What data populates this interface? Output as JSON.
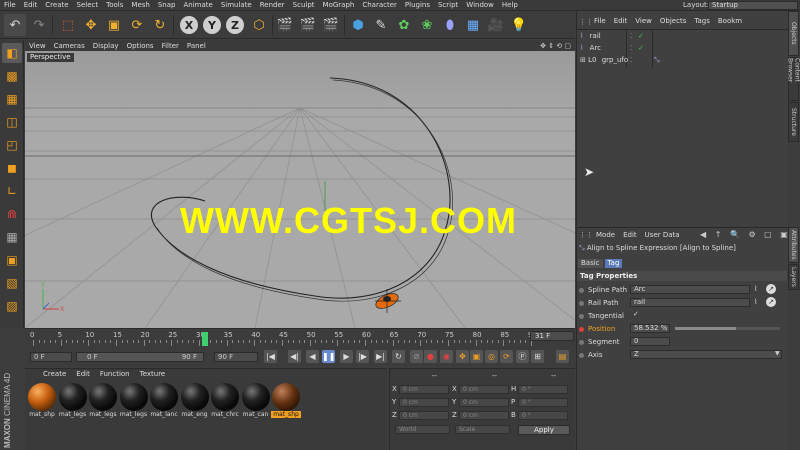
{
  "menu": [
    "File",
    "Edit",
    "Create",
    "Select",
    "Tools",
    "Mesh",
    "Snap",
    "Animate",
    "Simulate",
    "Render",
    "Sculpt",
    "MoGraph",
    "Character",
    "Plugins",
    "Script",
    "Window",
    "Help"
  ],
  "layout": {
    "label": "Layout:",
    "value": "Startup"
  },
  "axis_buttons": [
    "X",
    "Y",
    "Z"
  ],
  "viewport": {
    "menu": [
      "View",
      "Cameras",
      "Display",
      "Options",
      "Filter",
      "Panel"
    ],
    "name": "Perspective"
  },
  "watermark": "WWW.CGTSJ.COM",
  "timeline": {
    "ticks": [
      "0",
      "5",
      "10",
      "15",
      "20",
      "25",
      "30",
      "35",
      "40",
      "45",
      "50",
      "55",
      "60",
      "65",
      "70",
      "75",
      "80",
      "85",
      "90"
    ],
    "current": "31 F",
    "playhead": 31,
    "max": 90
  },
  "transport": {
    "start": "0 F",
    "range_start": "0 F",
    "range_end": "90 F",
    "end": "90 F"
  },
  "materials": {
    "menu": [
      "Create",
      "Edit",
      "Function",
      "Texture"
    ],
    "items": [
      "mat_shp",
      "mat_legs",
      "mat_legs",
      "mat_legs",
      "mat_lanc",
      "mat_eng",
      "mat_chrc",
      "mat_can",
      "mat_shp"
    ],
    "selected": 8
  },
  "coords": {
    "headers": [
      "--",
      "--",
      "--"
    ],
    "rows": [
      {
        "a": "X",
        "av": "0 cm",
        "b": "X",
        "bv": "0 cm",
        "c": "H",
        "cv": "0 °"
      },
      {
        "a": "Y",
        "av": "0 cm",
        "b": "Y",
        "bv": "0 cm",
        "c": "P",
        "cv": "0 °"
      },
      {
        "a": "Z",
        "av": "0 cm",
        "b": "Z",
        "bv": "0 cm",
        "c": "B",
        "cv": "0 °"
      }
    ],
    "space": "World",
    "mode": "Scale",
    "apply": "Apply"
  },
  "objects": {
    "menu": [
      "File",
      "Edit",
      "View",
      "Objects",
      "Tags",
      "Bookm"
    ],
    "rows": [
      "rail",
      "Arc",
      "grp_ufo"
    ]
  },
  "side_tabs": {
    "top": [
      "Objects",
      "Content Browser",
      "Structure"
    ],
    "bottom": [
      "Attributes",
      "Layers"
    ]
  },
  "attributes": {
    "menu": [
      "Mode",
      "Edit",
      "User Data"
    ],
    "title": "Align to Spline Expression [Align to Spline]",
    "tabs": [
      "Basic",
      "Tag"
    ],
    "section": "Tag Properties",
    "rows": [
      {
        "label": "Spline Path",
        "value": "Arc"
      },
      {
        "label": "Rail Path",
        "value": "rail"
      },
      {
        "label": "Tangential",
        "value": "✓"
      },
      {
        "label": "Position",
        "value": "58.532 %"
      },
      {
        "label": "Segment",
        "value": "0"
      },
      {
        "label": "Axis",
        "value": "Z"
      }
    ]
  },
  "brand": {
    "line1": "MAXON",
    "line2": "CINEMA 4D"
  },
  "colors": {
    "accent": "#f0a020",
    "watermark": "#ffff00",
    "viewport": "#a9a9a9"
  }
}
